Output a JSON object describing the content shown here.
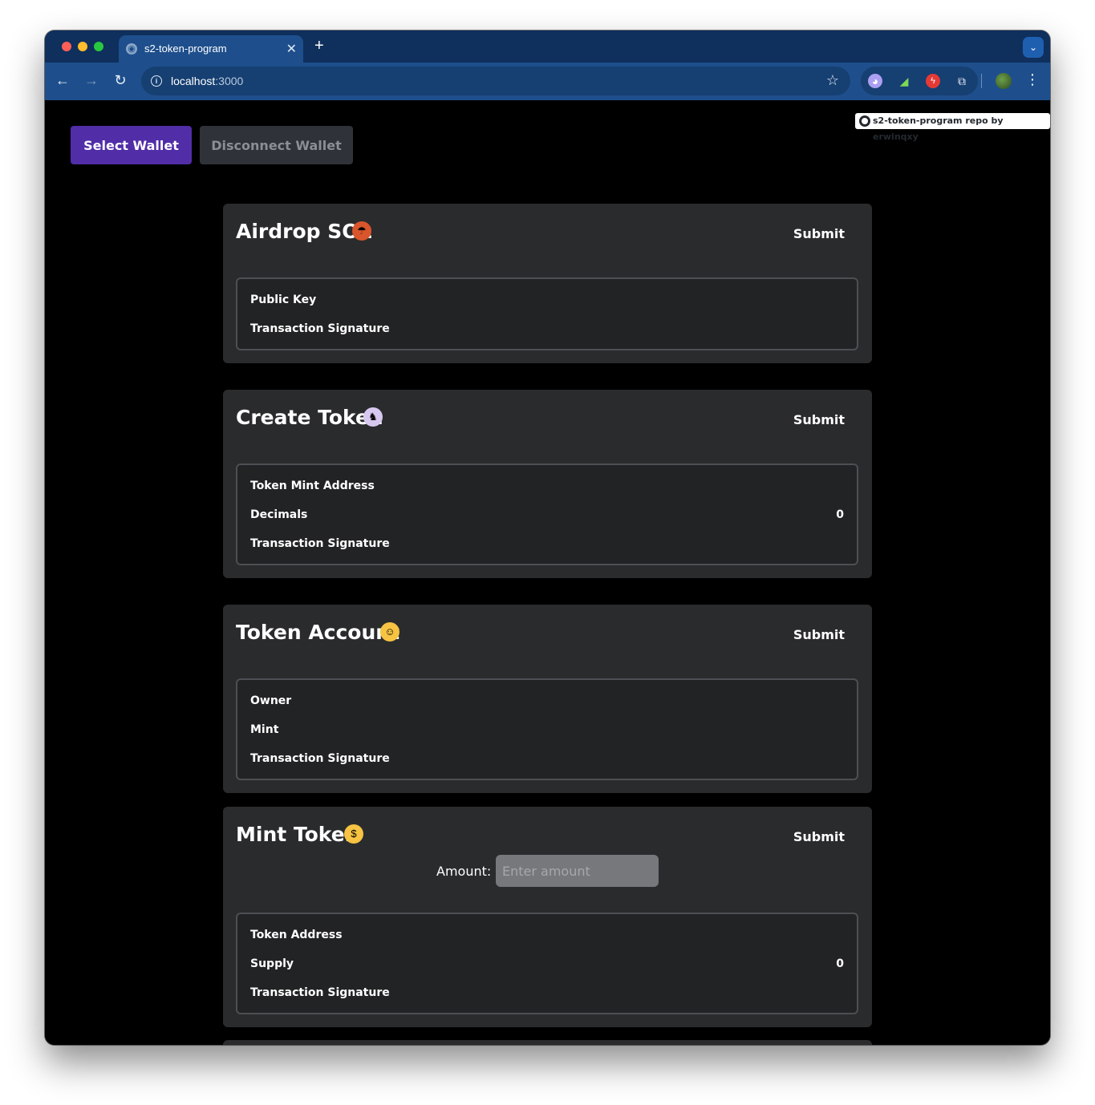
{
  "browser": {
    "tab_title": "s2-token-program",
    "url_host": "localhost",
    "url_port": ":3000",
    "icons": {
      "back": "←",
      "forward": "→",
      "reload": "↻",
      "star": "☆",
      "new_tab": "+",
      "close": "✕",
      "menu": "⋮",
      "dropdown": "⌄",
      "phantom": "◕",
      "chart": "◢",
      "bolt": "ϟ",
      "puzzle": "⧉",
      "info": "i",
      "favicon": "◉"
    }
  },
  "page": {
    "select_wallet": "Select Wallet",
    "disconnect_wallet": "Disconnect Wallet",
    "repo_badge": "s2-token-program repo by erwinqxy",
    "colors": {
      "select_wallet_bg": "#512da8",
      "card_bg": "#2a2b2d"
    }
  },
  "cards": [
    {
      "title": "Airdrop SOL",
      "emoji": "parachute",
      "submit": "Submit",
      "rows": [
        {
          "label": "Public Key",
          "value": ""
        },
        {
          "label": "Transaction Signature",
          "value": ""
        }
      ]
    },
    {
      "title": "Create Token",
      "emoji": "unicorn",
      "submit": "Submit",
      "rows": [
        {
          "label": "Token Mint Address",
          "value": ""
        },
        {
          "label": "Decimals",
          "value": "0"
        },
        {
          "label": "Transaction Signature",
          "value": ""
        }
      ]
    },
    {
      "title": "Token Account",
      "emoji": "partying-face",
      "submit": "Submit",
      "rows": [
        {
          "label": "Owner",
          "value": ""
        },
        {
          "label": "Mint",
          "value": ""
        },
        {
          "label": "Transaction Signature",
          "value": ""
        }
      ]
    },
    {
      "title": "Mint Token",
      "emoji": "money-mouth-face",
      "submit": "Submit",
      "amount_label": "Amount:",
      "amount_placeholder": "Enter amount",
      "rows": [
        {
          "label": "Token Address",
          "value": ""
        },
        {
          "label": "Supply",
          "value": "0"
        },
        {
          "label": "Transaction Signature",
          "value": ""
        }
      ]
    }
  ]
}
